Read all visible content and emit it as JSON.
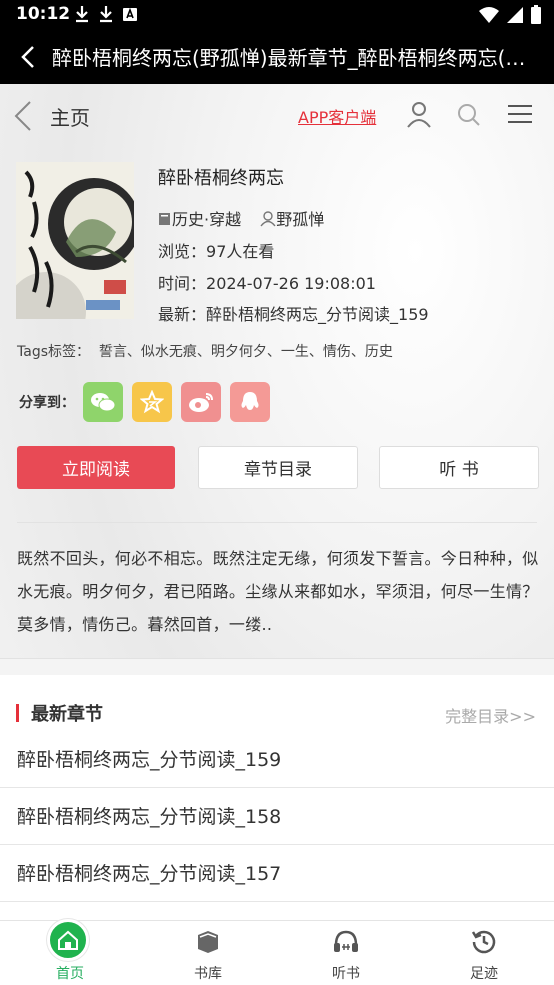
{
  "status_bar": {
    "time": "10:12"
  },
  "title_bar": {
    "title": "醉卧梧桐终两忘(野孤惮)最新章节_醉卧梧桐终两忘(野孤惮)全文"
  },
  "nav": {
    "home": "主页",
    "app_link": "APP客户端"
  },
  "book": {
    "title": "醉卧梧桐终两忘",
    "category": "历史·穿越",
    "author": "野孤惮",
    "views_label": "浏览：",
    "views": "97人在看",
    "time_label": "时间：",
    "time": "2024-07-26 19:08:01",
    "latest_label": "最新：",
    "latest": "醉卧梧桐终两忘_分节阅读_159"
  },
  "tags": {
    "label": "Tags标签：",
    "items": "誓言、似水无痕、明夕何夕、一生、情伤、历史"
  },
  "share": {
    "label": "分享到："
  },
  "actions": {
    "read": "立即阅读",
    "toc": "章节目录",
    "listen": "听 书"
  },
  "description": "既然不回头，何必不相忘。既然注定无缘，何须发下誓言。今日种种，似水无痕。明夕何夕，君已陌路。尘缘从来都如水，罕须泪，何尽一生情？莫多情，情伤己。暮然回首，一缕..",
  "latest_section": {
    "title": "最新章节",
    "full_link": "完整目录>>",
    "chapters": [
      "醉卧梧桐终两忘_分节阅读_159",
      "醉卧梧桐终两忘_分节阅读_158",
      "醉卧梧桐终两忘_分节阅读_157"
    ]
  },
  "tabbar": {
    "home": "首页",
    "library": "书库",
    "listen": "听书",
    "history": "足迹"
  },
  "colors": {
    "accent_red": "#e84a55",
    "accent_green": "#27ae60",
    "wechat": "#8fd46b",
    "favorite": "#f7c64a",
    "weibo": "#f09090",
    "qq": "#f49a96"
  }
}
